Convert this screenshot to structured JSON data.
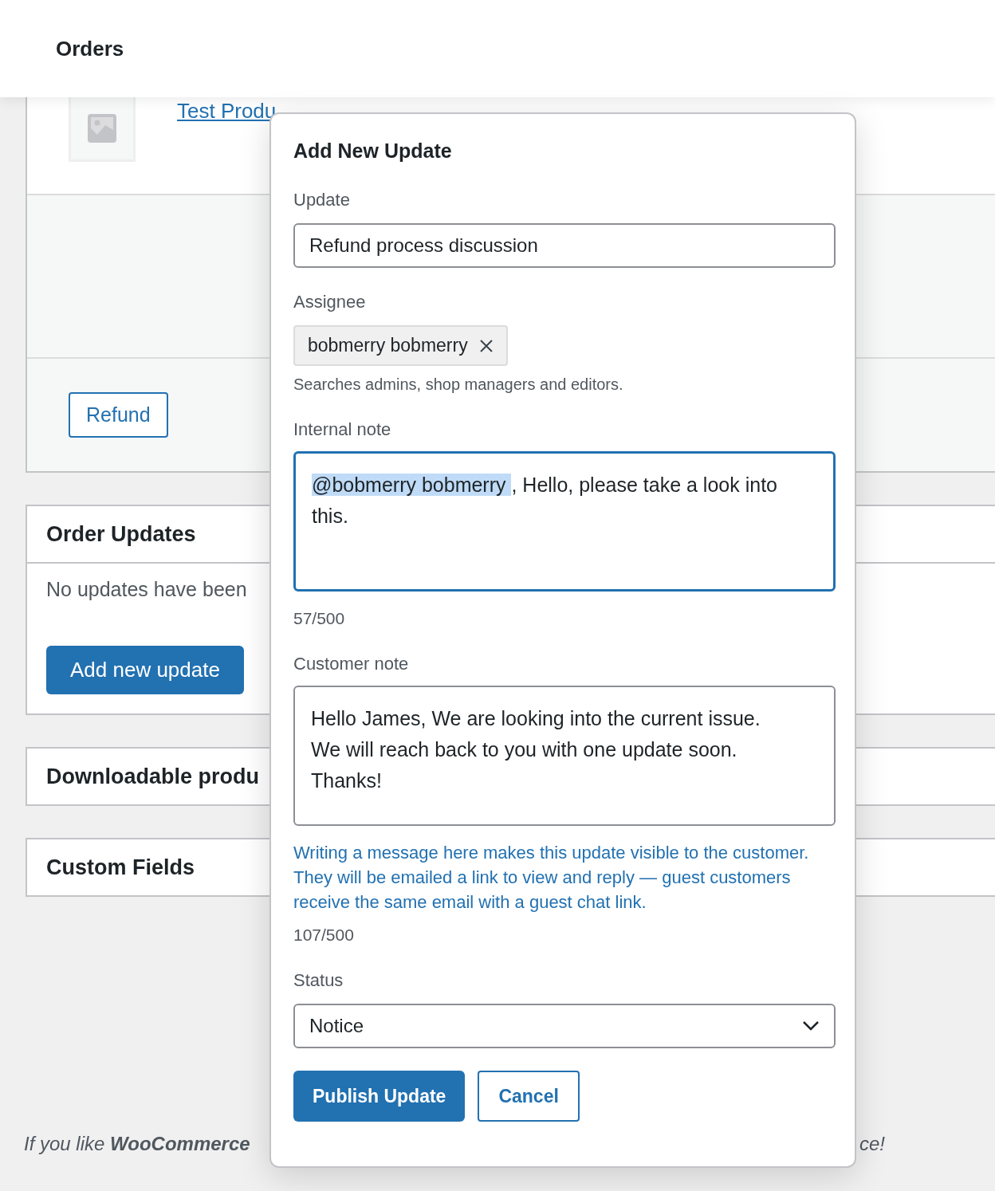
{
  "header": {
    "title": "Orders"
  },
  "order_items": {
    "product_link": "Test Produ",
    "refund_button": "Refund"
  },
  "panels": [
    {
      "kind": "updates",
      "title": "Order Updates",
      "empty_text": "No updates have been",
      "button": "Add new update"
    },
    {
      "kind": "plain",
      "title": "Downloadable produ"
    },
    {
      "kind": "plain",
      "title": "Custom Fields"
    }
  ],
  "footer": {
    "text": "If you like **WooCommerce**",
    "end_text": "ce!"
  },
  "modal": {
    "title": "Add New Update",
    "update": {
      "label": "Update",
      "value": "Refund process discussion"
    },
    "assignee": {
      "label": "Assignee",
      "chip": "bobmerry bobmerry",
      "help": "Searches admins, shop managers and editors."
    },
    "internal_note": {
      "label": "Internal note",
      "mention": "@bobmerry bobmerry ",
      "text": ", Hello, please take a look into this.",
      "focused": true,
      "count": "57/500"
    },
    "customer_note": {
      "label": "Customer note",
      "value": "Hello James, We are looking into the current issue.\nWe will reach back to you with one update soon.\nThanks!",
      "focused": false,
      "help": "Writing a message here makes this update visible to the customer. They will be emailed a link to view and reply — guest customers receive the same email with a guest chat link.",
      "count": "107/500"
    },
    "status": {
      "label": "Status",
      "value": "Notice"
    },
    "buttons": [
      {
        "kind": "primary",
        "label": "Publish Update"
      },
      {
        "kind": "secondary",
        "label": "Cancel"
      }
    ]
  }
}
